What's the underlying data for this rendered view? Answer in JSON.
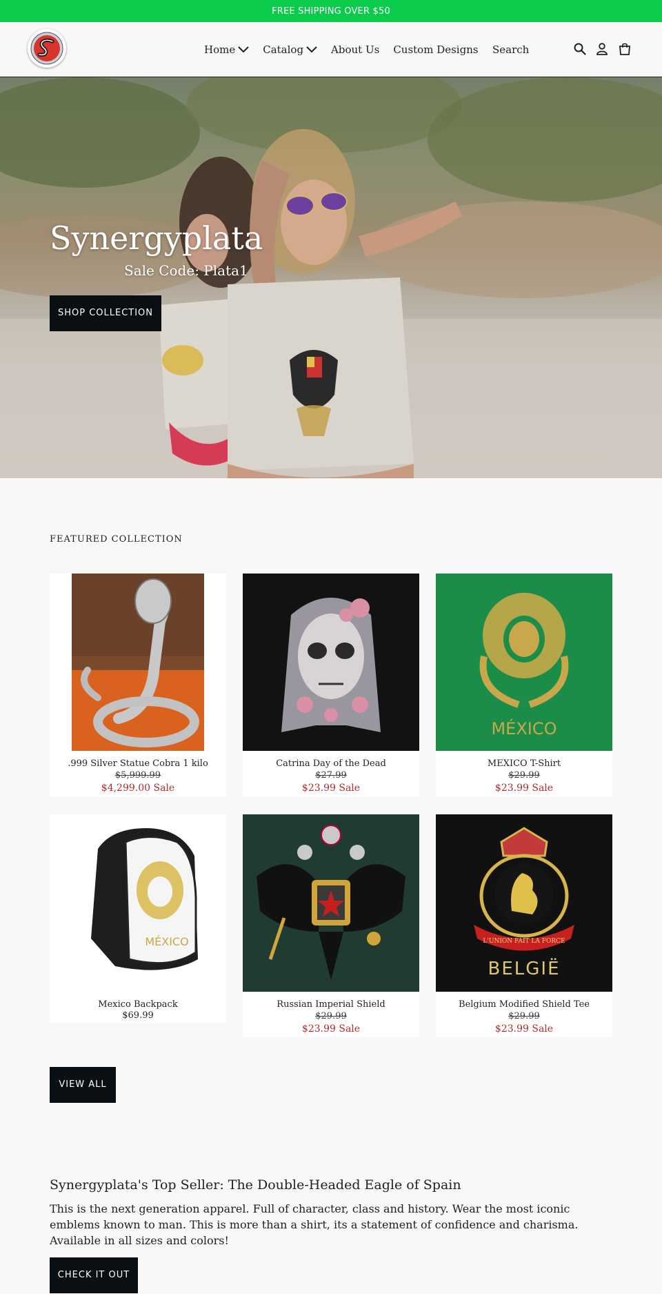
{
  "announcement": "FREE SHIPPING OVER $50",
  "header": {
    "nav": [
      {
        "label": "Home",
        "has_dropdown": true
      },
      {
        "label": "Catalog",
        "has_dropdown": true
      },
      {
        "label": "About Us",
        "has_dropdown": false
      },
      {
        "label": "Custom Designs",
        "has_dropdown": false
      }
    ],
    "search_label": "Search",
    "icons": [
      "search-icon",
      "account-icon",
      "cart-icon"
    ]
  },
  "hero": {
    "title": "Synergyplata",
    "subtitle": "Sale Code: Plata1",
    "button": "SHOP COLLECTION"
  },
  "featured": {
    "heading": "FEATURED COLLECTION",
    "products": [
      {
        "title": ".999 Silver Statue Cobra 1 kilo",
        "compare_price": "$5,999.99",
        "price": "$4,299.00 Sale"
      },
      {
        "title": "Catrina Day of the Dead",
        "compare_price": "$27.99",
        "price": "$23.99 Sale"
      },
      {
        "title": "MEXICO T-Shirt",
        "compare_price": "$29.99",
        "price": "$23.99 Sale",
        "image_text": "MÉXICO"
      },
      {
        "title": "Mexico Backpack",
        "price": "$69.99",
        "image_text": "MÉXICO"
      },
      {
        "title": "Russian Imperial Shield",
        "compare_price": "$29.99",
        "price": "$23.99 Sale"
      },
      {
        "title": "Belgium Modified Shield Tee",
        "compare_price": "$29.99",
        "price": "$23.99 Sale",
        "image_text": "BELGIË",
        "banner_text": "L'UNION FAIT LA FORCE"
      }
    ],
    "view_all": "VIEW ALL"
  },
  "top_seller": {
    "title": "Synergyplata's Top Seller: The Double-Headed Eagle of Spain",
    "body": "This is the next generation apparel. Full of character, class and history. Wear the most iconic emblems known to man. This is more than a shirt, its a statement of confidence and charisma. Available in all sizes and colors!",
    "button": "CHECK IT OUT"
  },
  "colors": {
    "announcement_bg": "#0acc4a",
    "button_bg": "#0a0f14",
    "sale": "#b22a2a"
  }
}
